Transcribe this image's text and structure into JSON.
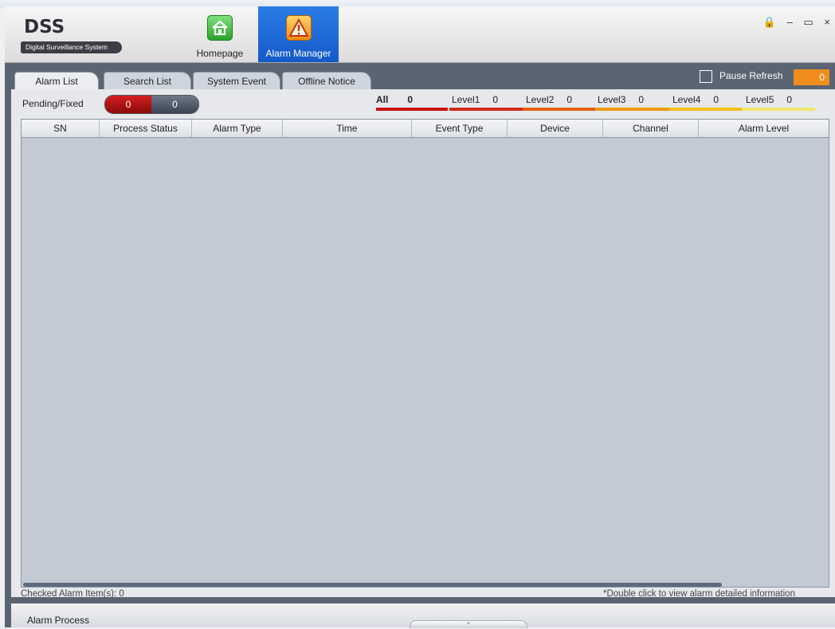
{
  "app": {
    "logo": "DSS",
    "subtitle": "Digital Surveillance System"
  },
  "nav": {
    "home": {
      "label": "Homepage",
      "icon": "home-icon"
    },
    "alarm": {
      "label": "Alarm Manager",
      "icon": "alarm-warning-icon"
    }
  },
  "window_controls": {
    "lock": "🔒",
    "minimize": "–",
    "maximize": "▭",
    "close": "×"
  },
  "tabs": [
    {
      "label": "Alarm List",
      "active": true
    },
    {
      "label": "Search List",
      "active": false
    },
    {
      "label": "System Event",
      "active": false
    },
    {
      "label": "Offline Notice",
      "active": false
    }
  ],
  "pause": {
    "label": "Pause Refresh",
    "count": "0"
  },
  "pending": {
    "label": "Pending/Fixed",
    "pending": "0",
    "fixed": "0"
  },
  "levels": [
    {
      "label": "All",
      "count": "0",
      "color": "#cc1111"
    },
    {
      "label": "Level1",
      "count": "0",
      "color": "#d22a1a"
    },
    {
      "label": "Level2",
      "count": "0",
      "color": "#e55f12"
    },
    {
      "label": "Level3",
      "count": "0",
      "color": "#ef9a12"
    },
    {
      "label": "Level4",
      "count": "0",
      "color": "#f2c01a"
    },
    {
      "label": "Level5",
      "count": "0",
      "color": "#f3e76a"
    }
  ],
  "table": {
    "columns": [
      "SN",
      "Process Status",
      "Alarm Type",
      "Time",
      "Event Type",
      "Device",
      "Channel",
      "Alarm Level"
    ],
    "rows": []
  },
  "footer": {
    "checked": "Checked Alarm Item(s): 0",
    "hint": "*Double click to view alarm detailed information"
  },
  "bottom": {
    "label": "Alarm Process",
    "expander": "^"
  }
}
